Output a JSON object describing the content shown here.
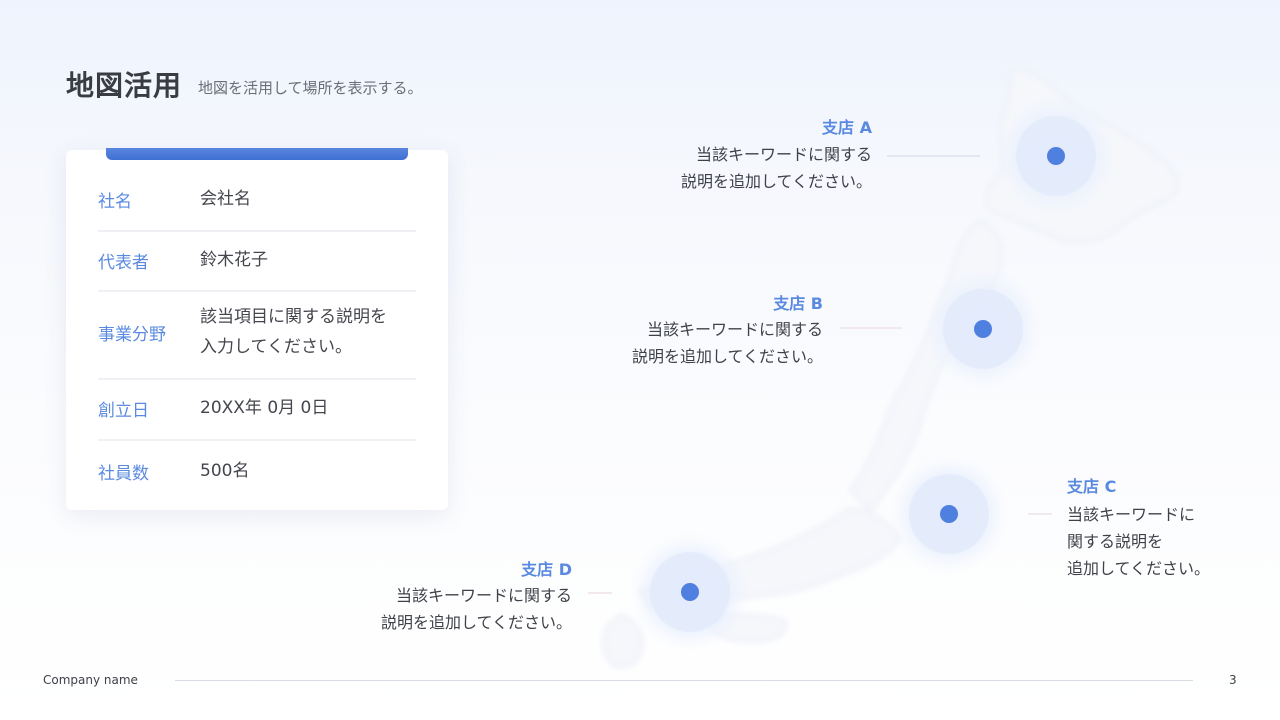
{
  "header": {
    "title": "地図活用",
    "subtitle": "地図を活用して場所を表示する。"
  },
  "company_card": {
    "rows": [
      {
        "label": "社名",
        "value": "会社名"
      },
      {
        "label": "代表者",
        "value": "鈴木花子"
      },
      {
        "label": "事業分野",
        "value_line1": "該当項目に関する説明を",
        "value_line2": "入力してください。"
      },
      {
        "label": "創立日",
        "value": "20XX年 0月 0日"
      },
      {
        "label": "社員数",
        "value": "500名"
      }
    ]
  },
  "branches": [
    {
      "name": "支店 A",
      "desc_line1": "当該キーワードに関する",
      "desc_line2": "説明を追加してください。"
    },
    {
      "name": "支店 B",
      "desc_line1": "当該キーワードに関する",
      "desc_line2": "説明を追加してください。"
    },
    {
      "name": "支店 C",
      "desc_line1": "当該キーワードに",
      "desc_line2": "関する説明を",
      "desc_line3": "追加してください。"
    },
    {
      "name": "支店 D",
      "desc_line1": "当該キーワードに関する",
      "desc_line2": "説明を追加してください。"
    }
  ],
  "colors": {
    "accent": "#5a8ae0",
    "marker": "#4f80e0",
    "card_bar": "#4673d4"
  },
  "icons": [
    "location-marker-icon"
  ],
  "footer": {
    "company": "Company name",
    "page_number": "3"
  }
}
